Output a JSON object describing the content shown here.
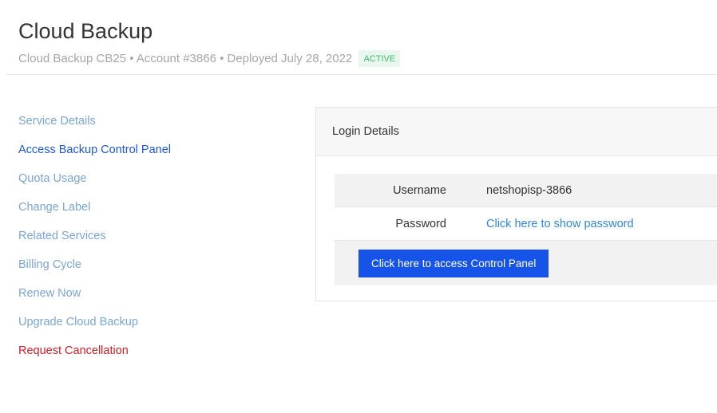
{
  "header": {
    "title": "Cloud Backup",
    "subtitle": "Cloud Backup CB25 • Account #3866 • Deployed July 28, 2022",
    "status": "ACTIVE"
  },
  "sidebar": {
    "items": [
      {
        "label": "Service Details"
      },
      {
        "label": "Access Backup Control Panel"
      },
      {
        "label": "Quota Usage"
      },
      {
        "label": "Change Label"
      },
      {
        "label": "Related Services"
      },
      {
        "label": "Billing Cycle"
      },
      {
        "label": "Renew Now"
      },
      {
        "label": "Upgrade Cloud Backup"
      },
      {
        "label": "Request Cancellation"
      }
    ],
    "active_index": 1
  },
  "login_panel": {
    "heading": "Login Details",
    "username_label": "Username",
    "username_value": "netshopisp-3866",
    "password_label": "Password",
    "password_link": "Click here to show password",
    "access_button": "Click here to access Control Panel"
  },
  "colors": {
    "link": "#7aa6d4",
    "active_link": "#1e57d6",
    "danger": "#cc1f24",
    "primary_button": "#1653e8",
    "badge_bg": "#e9f7ee",
    "badge_text": "#3cbf6b"
  }
}
